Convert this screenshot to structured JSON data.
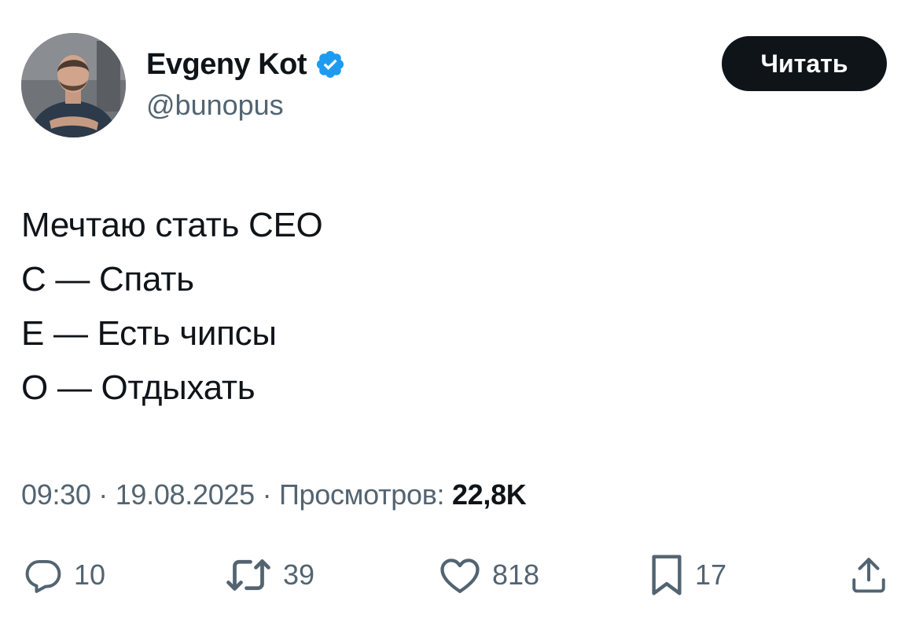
{
  "author": {
    "name": "Evgeny Kot",
    "handle": "@bunopus",
    "verified": true,
    "verified_color": "#1d9bf0",
    "avatar_icon": "profile-photo"
  },
  "read_button": {
    "label": "Читать"
  },
  "tweet": {
    "lines": [
      "Мечтаю стать СЕО",
      "С — Спать",
      "Е — Есть чипсы",
      "О — Отдыхать"
    ]
  },
  "meta": {
    "time": "09:30",
    "separator": " · ",
    "date": "19.08.2025",
    "views_label": "Просмотров: ",
    "views_count": "22,8K"
  },
  "actions": {
    "reply": {
      "icon": "reply-icon",
      "count": "10"
    },
    "retweet": {
      "icon": "retweet-icon",
      "count": "39"
    },
    "like": {
      "icon": "heart-icon",
      "count": "818"
    },
    "bookmark": {
      "icon": "bookmark-icon",
      "count": "17"
    },
    "share": {
      "icon": "share-icon"
    }
  },
  "colors": {
    "text": "#0f1419",
    "secondary": "#536471",
    "button_bg": "#0f1419",
    "verified": "#1d9bf0"
  }
}
